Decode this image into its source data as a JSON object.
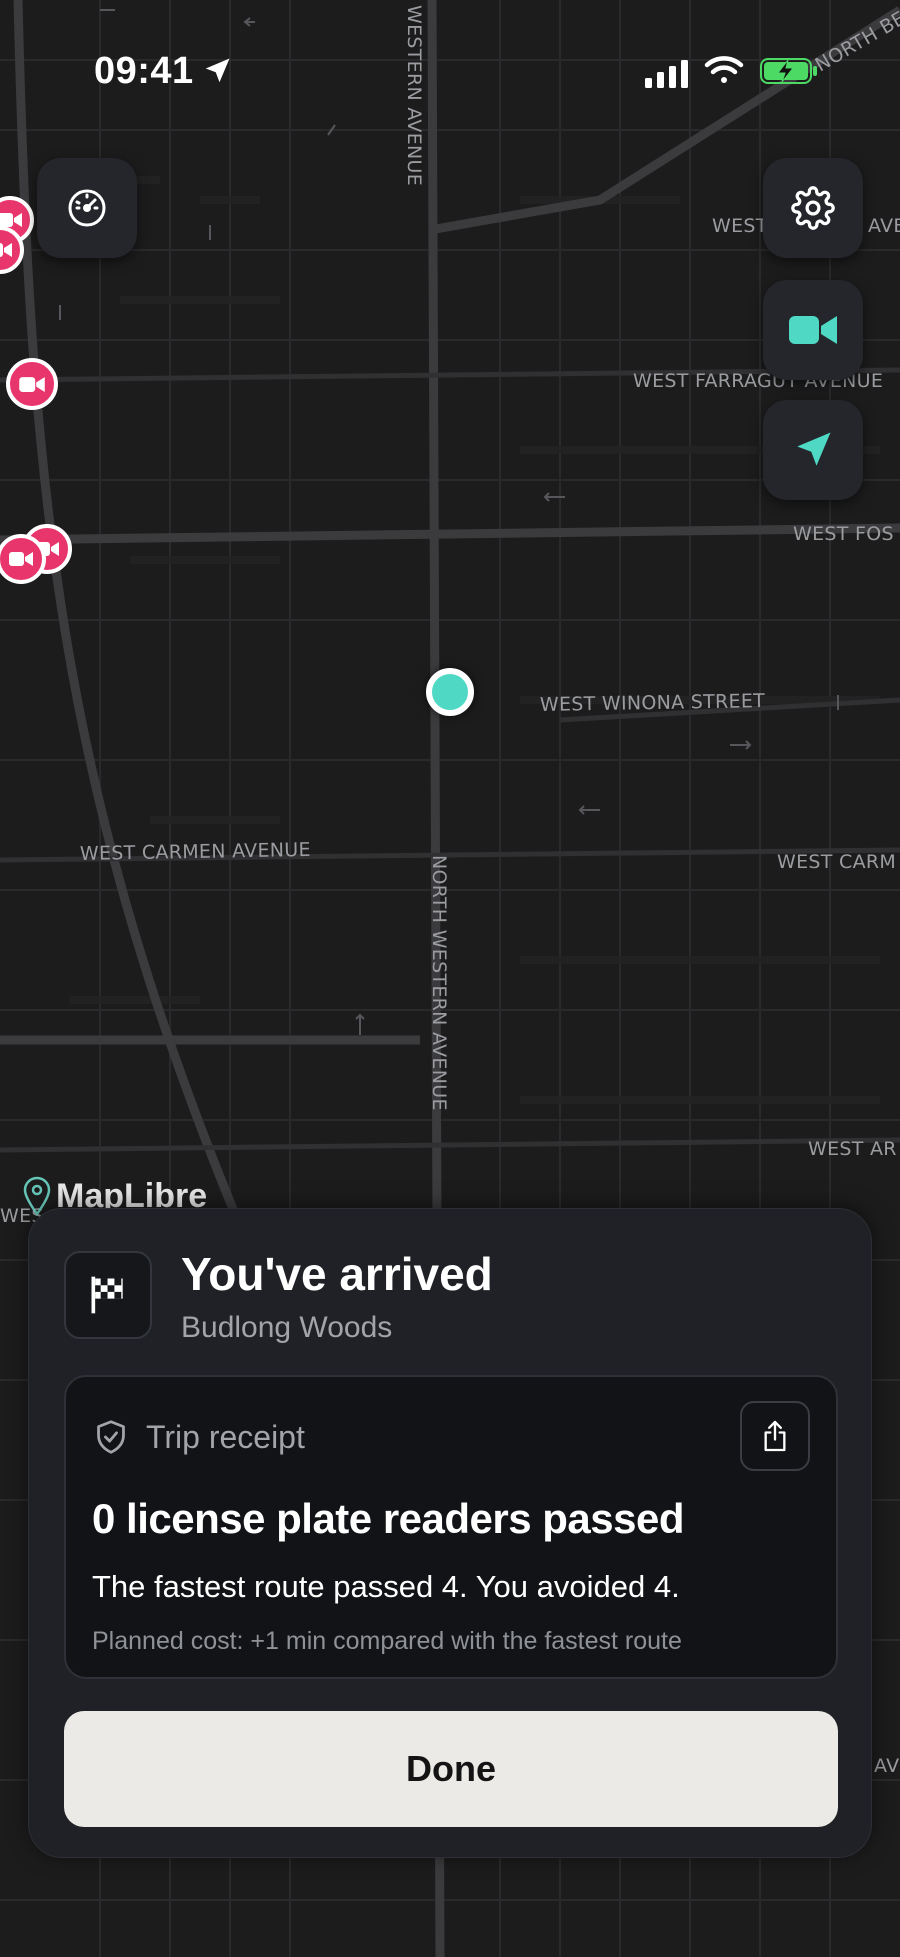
{
  "status_bar": {
    "time": "09:41",
    "icons": [
      "location-arrow-icon",
      "cellular-signal-icon",
      "wifi-icon",
      "battery-charging-icon"
    ]
  },
  "map": {
    "street_labels": [
      "WESTERN AVENUE",
      "NORTH BE",
      "WEST",
      "AVE",
      "WEST FARRAGUT AVENUE",
      "WEST FOS",
      "WEST WINONA STREET",
      "WEST CARMEN AVENUE",
      "WEST CARM",
      "NORTH WESTERN AVENUE",
      "WEST AR",
      "WES",
      "AV"
    ],
    "attribution": "MapLibre",
    "user_location_color": "#4fd8c4",
    "camera_marker_color": "#e8366d"
  },
  "controls": {
    "speedometer": "speedometer-icon",
    "settings": "gear-icon",
    "cameras": "video-camera-icon",
    "recenter": "navigation-arrow-icon",
    "accent": "#4fd8c4"
  },
  "arrival": {
    "icon": "checkered-flag-icon",
    "title": "You've arrived",
    "place": "Budlong Woods"
  },
  "receipt": {
    "icon": "shield-check-icon",
    "label": "Trip receipt",
    "share_icon": "share-icon",
    "headline": "0 license plate readers passed",
    "detail": "The fastest route passed 4. You avoided 4.",
    "cost": "Planned cost: +1 min compared with the fastest route"
  },
  "done_label": "Done"
}
